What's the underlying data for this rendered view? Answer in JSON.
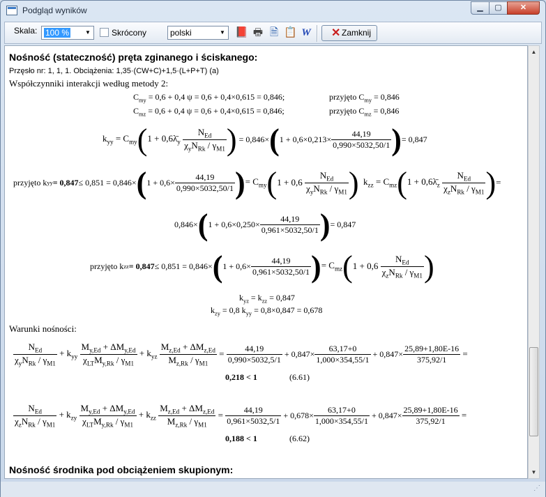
{
  "window": {
    "title": "Podgląd wyników",
    "min_glyph": "▁",
    "max_glyph": "▢",
    "close_glyph": "✕"
  },
  "toolbar": {
    "scale_label": "Skala:",
    "scale_value": "100 %",
    "short_label": "Skrócony",
    "language_value": "polski",
    "close_label": "Zamknij",
    "icons": [
      "book-icon",
      "printer-icon",
      "document-icon",
      "clipboard-icon",
      "word-icon"
    ]
  },
  "report": {
    "section1_title": "Nośność (stateczność) pręta zginanego i ściskanego:",
    "member_info": "Przęsło nr: 1, 1, 1. Obciążenia: 1,35·(CW+C)+1,5·(L+P+T) (a)",
    "coef_title": "Współczynniki interakcji według metody 2:",
    "cmy_eq": "C",
    "cmy_sub": "my",
    "cmy_rest": " = 0,6 + 0,4 ψ = 0,6 + 0,4×0,615 = 0,846;",
    "cmy_adopted": "przyjęto C",
    "cmy_adopted_val": " = 0,846",
    "cmz_sub": "mz",
    "cmz_rest": " = 0,6 + 0,4 ψ = 0,6 + 0,4×0,615 = 0,846;",
    "cmz_adopted_val": " = 0,846",
    "kyy_val1": "0,846×",
    "kyy_inner1": "1 + 0,6×0,213×",
    "kyy_num": "44,19",
    "kyy_den": "0,990×5032,50/1",
    "kyy_result": "= 0,847",
    "kyy_adopted": "przyjęto k",
    "kyy_adopted_val": " = 0,847",
    "kyy_limit": " ≤ 0,851 = 0,846×",
    "inner_1_06x": "1 + 0,6×",
    "kzz_val": "0,846×",
    "kzz_inner": "1 + 0,6×0,250×",
    "kzz_num": "44,19",
    "kzz_den": "0,961×5032,50/1",
    "kzz_result": "= 0,847",
    "kzz_adopted_val": " = 0,847",
    "kyz_line": " = k",
    "kyz_val": " = 0,847",
    "kzy_line": " = 0,8 k",
    "kzy_val": " = 0,8×0,847 = 0,678",
    "conditions_title": "Warunki nośności:",
    "cond1_a": "44,19",
    "cond1_a_den": "0,990×5032,5/1",
    "cond1_k1": "+ 0,847×",
    "cond1_b": "63,17+0",
    "cond1_b_den": "1,000×354,55/1",
    "cond1_k2": "+ 0,847×",
    "cond1_c": "25,89+1,80E-16",
    "cond1_c_den": "375,92/1",
    "cond1_result": "0,218 < 1",
    "cond1_ref": "(6.61)",
    "cond2_a": "44,19",
    "cond2_a_den": "0,961×5032,5/1",
    "cond2_k1": "+ 0,678×",
    "cond2_b": "63,17+0",
    "cond2_b_den": "1,000×354,55/1",
    "cond2_k2": "+ 0,847×",
    "cond2_c": "25,89+1,80E-16",
    "cond2_c_den": "375,92/1",
    "cond2_result": "0,188 < 1",
    "cond2_ref": "(6.62)",
    "section2_title": "Nośność środnika pod obciążeniem skupionym:"
  }
}
